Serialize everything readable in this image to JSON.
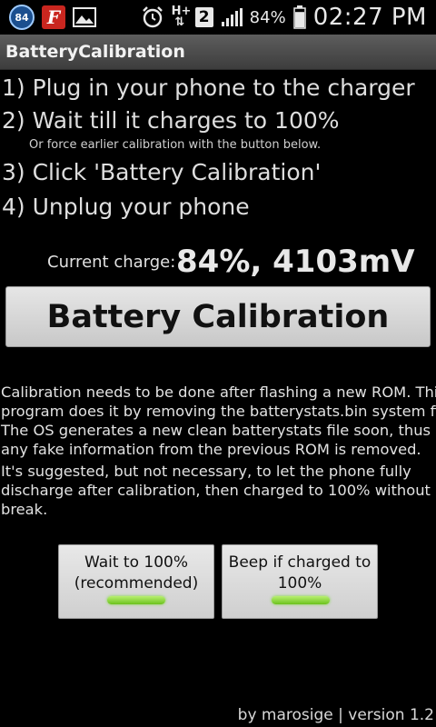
{
  "status_bar": {
    "notification_count": "84",
    "flipboard_letter": "F",
    "network_type": "H+",
    "sim_slot": "2",
    "battery_percent": "84%",
    "battery_level": 0.84,
    "time": "02:27 PM"
  },
  "app": {
    "title": "BatteryCalibration"
  },
  "instructions": {
    "step1": "1) Plug in your phone to the charger",
    "step2": "2) Wait till it charges to 100%",
    "step2_note": "Or force earlier calibration with the button below.",
    "step3": "3) Click 'Battery Calibration'",
    "step4": "4) Unplug your phone"
  },
  "charge": {
    "label": "Current charge:",
    "value": "84%, 4103mV"
  },
  "calibrate_button": {
    "label": "Battery Calibration"
  },
  "description": {
    "p1_lines": [
      "Calibration needs to be done after flashing a new ROM. This",
      "program does it by removing the batterystats.bin system file.",
      "The OS generates a new clean batterystats file soon, thus",
      "any fake information from the previous ROM is removed."
    ],
    "p2_lines": [
      "It's suggested, but not necessary, to let the phone fully",
      "discharge after calibration, then charged to 100% without",
      "break."
    ]
  },
  "toggles": [
    {
      "label_lines": [
        "Wait to 100%",
        "(recommended)"
      ],
      "checked": true
    },
    {
      "label_lines": [
        "Beep if charged to",
        "100%"
      ],
      "checked": true
    }
  ],
  "footer": {
    "credit": "by marosige | version 1.2"
  },
  "colors": {
    "indicator_on": "#7ed83a",
    "titlebar": "#4a4a4a",
    "background": "#000000"
  }
}
